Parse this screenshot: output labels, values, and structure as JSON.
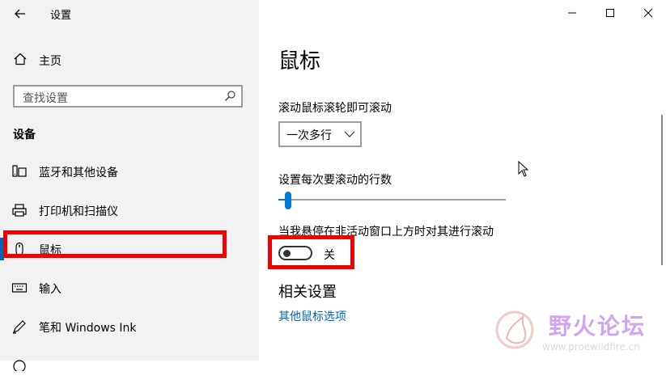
{
  "window": {
    "title": "设置",
    "controls": {
      "minimize": "minimize-icon",
      "maximize": "maximize-icon",
      "close": "close-icon"
    }
  },
  "sidebar": {
    "home_label": "主页",
    "search_placeholder": "查找设置",
    "section_title": "设备",
    "items": [
      {
        "label": "蓝牙和其他设备",
        "icon": "bluetooth-devices-icon"
      },
      {
        "label": "打印机和扫描仪",
        "icon": "printer-icon"
      },
      {
        "label": "鼠标",
        "icon": "mouse-icon",
        "selected": true
      },
      {
        "label": "输入",
        "icon": "keyboard-icon"
      },
      {
        "label": "笔和 Windows Ink",
        "icon": "pen-icon"
      }
    ]
  },
  "main": {
    "title": "鼠标",
    "scroll": {
      "label": "滚动鼠标滚轮即可滚动",
      "value": "一次多行"
    },
    "lines": {
      "label": "设置每次要滚动的行数",
      "level": 0.02
    },
    "inactive_scroll": {
      "label": "当我悬停在非活动窗口上方时对其进行滚动",
      "state": "关"
    },
    "related": {
      "title": "相关设置",
      "link": "其他鼠标选项"
    }
  },
  "watermark": {
    "text": "野火论坛",
    "url": "www.proewildfire.cn"
  },
  "colors": {
    "accent": "#0078d7",
    "link": "#0067c0",
    "highlight_box": "#f20000",
    "sidebar_bg": "#f2f2f2"
  }
}
